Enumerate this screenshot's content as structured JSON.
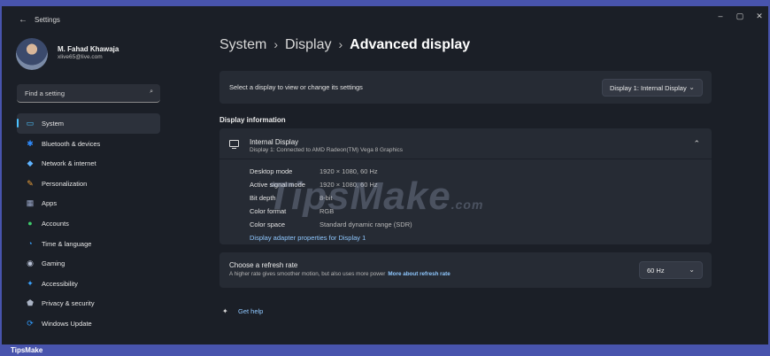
{
  "window": {
    "title": "Settings",
    "back_icon": "←",
    "minimize_icon": "–",
    "maximize_icon": "▢",
    "close_icon": "✕"
  },
  "user": {
    "name": "M. Fahad Khawaja",
    "email": "xlive65@live.com"
  },
  "search": {
    "placeholder": "Find a setting",
    "icon": "⌕"
  },
  "nav": {
    "items": [
      {
        "label": "System",
        "icon": "system-icon",
        "active": true,
        "color": "#4cc2ff"
      },
      {
        "label": "Bluetooth & devices",
        "icon": "bluetooth-icon",
        "color": "#2f8cff"
      },
      {
        "label": "Network & internet",
        "icon": "network-icon",
        "color": "#5fb3ff"
      },
      {
        "label": "Personalization",
        "icon": "personalization-icon",
        "color": "#f0a23a"
      },
      {
        "label": "Apps",
        "icon": "apps-icon",
        "color": "#9aa7c8"
      },
      {
        "label": "Accounts",
        "icon": "accounts-icon",
        "color": "#3ec96b"
      },
      {
        "label": "Time & language",
        "icon": "time-language-icon",
        "color": "#3aa3ff"
      },
      {
        "label": "Gaming",
        "icon": "gaming-icon",
        "color": "#b9c2d6"
      },
      {
        "label": "Accessibility",
        "icon": "accessibility-icon",
        "color": "#3aa3ff"
      },
      {
        "label": "Privacy & security",
        "icon": "privacy-shield-icon",
        "color": "#aab3c4"
      },
      {
        "label": "Windows Update",
        "icon": "windows-update-icon",
        "color": "#2f9bff"
      }
    ]
  },
  "breadcrumb": {
    "part1": "System",
    "part2": "Display",
    "part3": "Advanced display",
    "separator": "›"
  },
  "display_select": {
    "label": "Select a display to view or change its settings",
    "value": "Display 1: Internal Display",
    "chevron": "⌄"
  },
  "display_info": {
    "section_title": "Display information",
    "name": "Internal Display",
    "subtitle": "Display 1: Connected to AMD Radeon(TM) Vega 8 Graphics",
    "chevron": "⌃",
    "rows": [
      {
        "key": "Desktop mode",
        "value": "1920 × 1080, 60 Hz"
      },
      {
        "key": "Active signal mode",
        "value": "1920 × 1080, 60 Hz"
      },
      {
        "key": "Bit depth",
        "value": "8-bit"
      },
      {
        "key": "Color format",
        "value": "RGB"
      },
      {
        "key": "Color space",
        "value": "Standard dynamic range (SDR)"
      }
    ],
    "adapter_link": "Display adapter properties for Display 1"
  },
  "refresh": {
    "title": "Choose a refresh rate",
    "description": "A higher rate gives smoother motion, but also uses more power",
    "link": "More about refresh rate",
    "value": "60 Hz",
    "chevron": "⌄"
  },
  "help": {
    "label": "Get help",
    "icon": "✦"
  },
  "watermark": {
    "text": "TipsMake",
    "suffix": ".com"
  },
  "brand": {
    "text": "TipsMake"
  }
}
